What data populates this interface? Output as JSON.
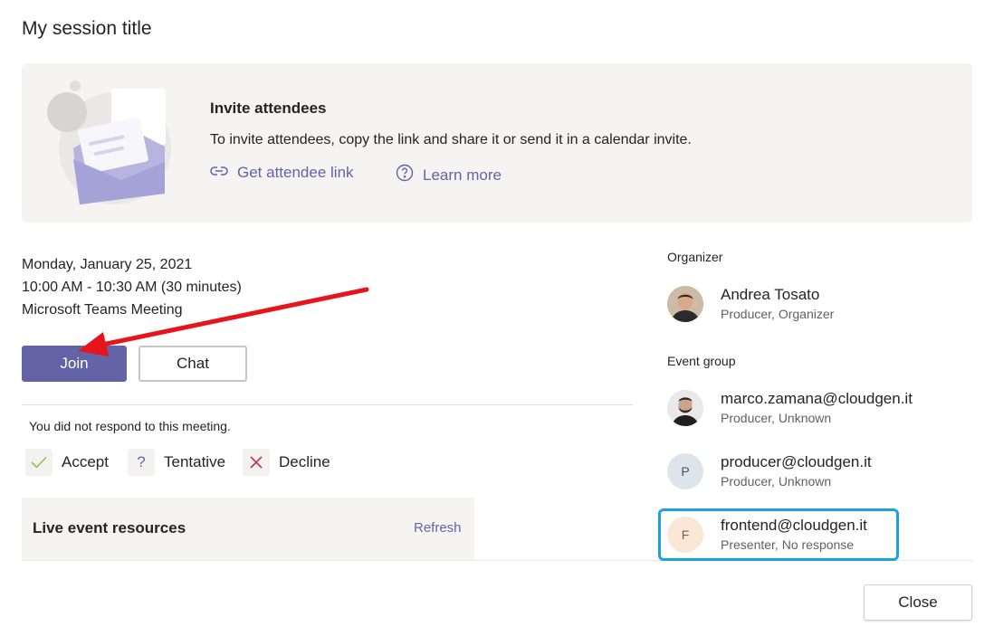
{
  "dialog": {
    "title": "My session title",
    "close_label": "Close"
  },
  "invite": {
    "heading": "Invite attendees",
    "description": "To invite attendees, copy the link and share it or send it in a calendar invite.",
    "attendee_link_label": "Get attendee link",
    "learn_more_label": "Learn more"
  },
  "meeting": {
    "date": "Monday, January 25, 2021",
    "time": "10:00 AM - 10:30 AM (30 minutes)",
    "type": "Microsoft Teams Meeting",
    "join_label": "Join",
    "chat_label": "Chat",
    "response_status": "You did not respond to this meeting.",
    "accept_label": "Accept",
    "tentative_label": "Tentative",
    "decline_label": "Decline"
  },
  "resources": {
    "title": "Live event resources",
    "refresh_label": "Refresh"
  },
  "organizer": {
    "label": "Organizer",
    "name": "Andrea Tosato",
    "role": "Producer, Organizer"
  },
  "event_group": {
    "label": "Event group",
    "members": [
      {
        "name": "marco.zamana@cloudgen.it",
        "role": "Producer, Unknown",
        "initial": ""
      },
      {
        "name": "producer@cloudgen.it",
        "role": "Producer, Unknown",
        "initial": "P"
      },
      {
        "name": "frontend@cloudgen.it",
        "role": "Presenter, No response",
        "initial": "F"
      }
    ]
  },
  "colors": {
    "brand": "#6264a7",
    "highlight": "#1ba1e2",
    "annotation_arrow": "#e8141b",
    "accept_check": "#92c353",
    "decline_x": "#c4314b"
  }
}
